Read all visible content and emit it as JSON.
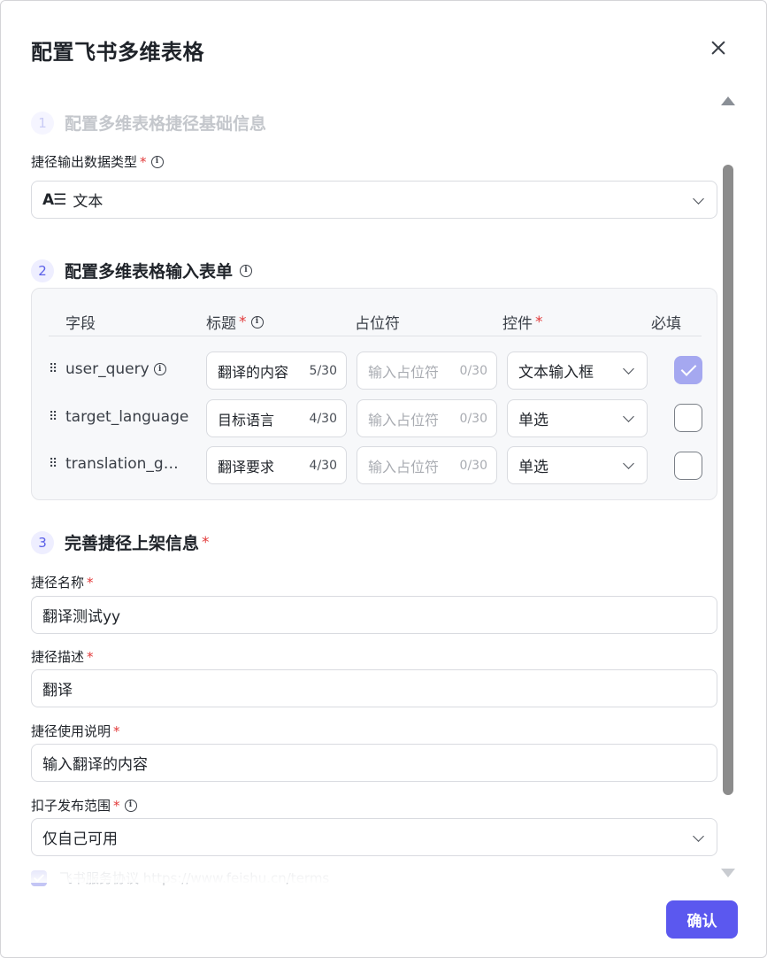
{
  "dialog": {
    "title": "配置飞书多维表格",
    "confirm_label": "确认"
  },
  "section1": {
    "num": "1",
    "title": "配置多维表格捷径基础信息",
    "output_type_label": "捷径输出数据类型",
    "output_type_value": "文本",
    "output_type_icon_text": "A☰"
  },
  "section2": {
    "num": "2",
    "title": "配置多维表格输入表单",
    "headers": {
      "field": "字段",
      "title": "标题",
      "placeholder": "占位符",
      "control": "控件",
      "required": "必填"
    },
    "rows": [
      {
        "field": "user_query",
        "title": "翻译的内容",
        "title_count": "5/30",
        "placeholder": "输入占位符",
        "placeholder_count": "0/30",
        "control": "文本输入框",
        "required": true
      },
      {
        "field": "target_language",
        "title": "目标语言",
        "title_count": "4/30",
        "placeholder": "输入占位符",
        "placeholder_count": "0/30",
        "control": "单选",
        "required": false
      },
      {
        "field": "translation_g…",
        "title": "翻译要求",
        "title_count": "4/30",
        "placeholder": "输入占位符",
        "placeholder_count": "0/30",
        "control": "单选",
        "required": false
      }
    ]
  },
  "section3": {
    "num": "3",
    "title": "完善捷径上架信息",
    "name_label": "捷径名称",
    "name_value": "翻译测试yy",
    "desc_label": "捷径描述",
    "desc_value": "翻译",
    "usage_label": "捷径使用说明",
    "usage_value": "输入翻译的内容",
    "scope_label": "扣子发布范围",
    "scope_value": "仅自己可用",
    "terms_text": "飞书服务协议 https://www.feishu.cn/terms"
  },
  "required_mark": "*",
  "info_glyph": "i",
  "drag_glyph": "⠿",
  "colors": {
    "accent": "#5b58ef",
    "required": "#e23a3a",
    "checkbox_checked": "#a5a8f0"
  },
  "icons": [
    "close-icon",
    "info-icon",
    "chevron-down-icon",
    "drag-handle-icon",
    "text-type-icon",
    "check-icon"
  ]
}
